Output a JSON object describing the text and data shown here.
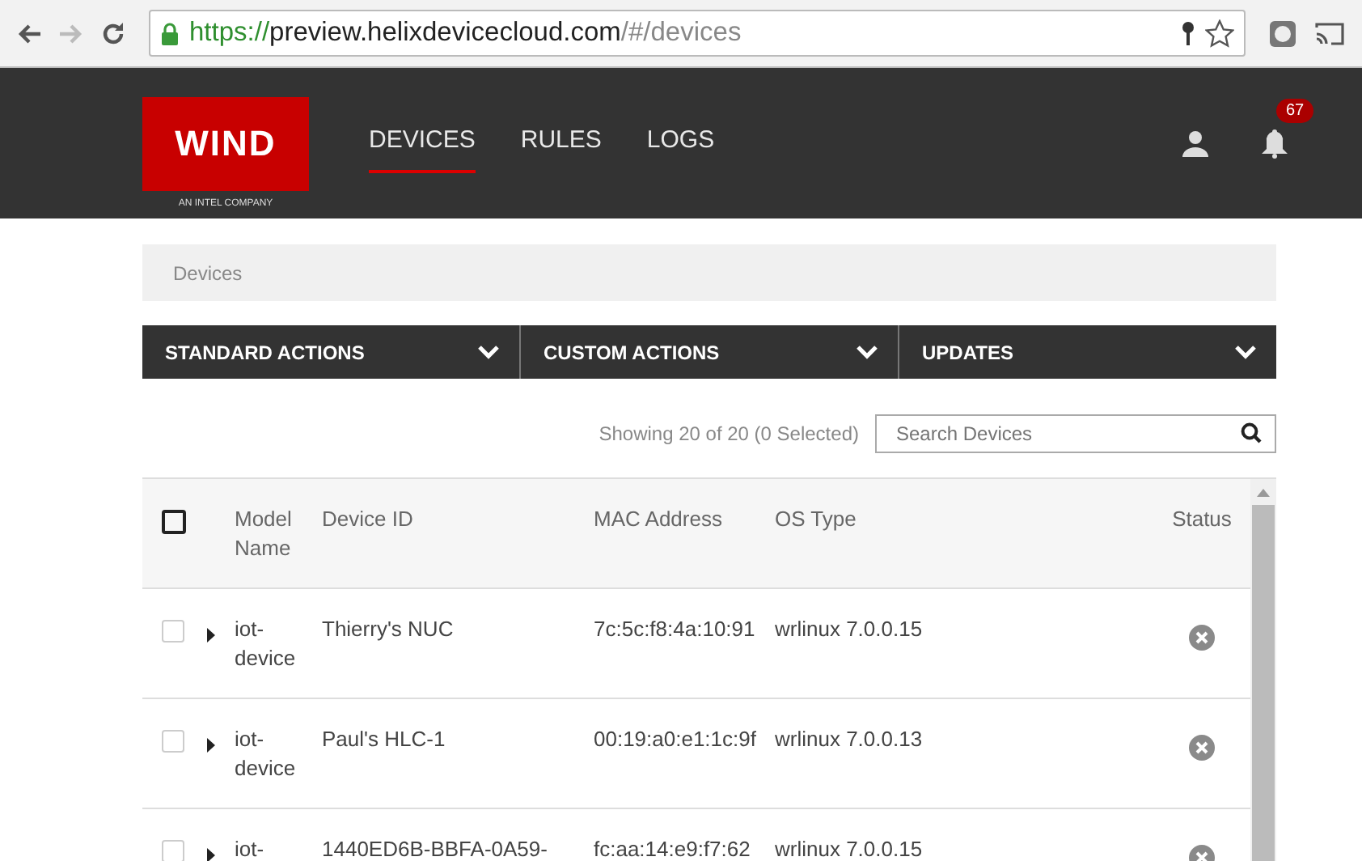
{
  "browser": {
    "url_scheme": "https://",
    "url_host": "preview.helixdevicecloud.com",
    "url_path": "/#/devices"
  },
  "header": {
    "logo": "WIND",
    "logo_tagline": "AN INTEL COMPANY",
    "nav": [
      {
        "label": "DEVICES",
        "selected": true
      },
      {
        "label": "RULES",
        "selected": false
      },
      {
        "label": "LOGS",
        "selected": false
      }
    ],
    "notification_count": "67"
  },
  "breadcrumb": "Devices",
  "action_menus": [
    "STANDARD ACTIONS",
    "CUSTOM ACTIONS",
    "UPDATES"
  ],
  "summary": "Showing 20 of 20 (0 Selected)",
  "search": {
    "placeholder": "Search Devices"
  },
  "table": {
    "select_all_checked": false,
    "columns": [
      "Model Name",
      "Device ID",
      "MAC Address",
      "OS Type",
      "Status"
    ],
    "rows": [
      {
        "checked": false,
        "model": "iot-device",
        "device_id": "Thierry's NUC",
        "mac": "7c:5c:f8:4a:10:91",
        "os": "wrlinux 7.0.0.15",
        "kind": "offline"
      },
      {
        "checked": false,
        "model": "iot-device",
        "device_id": "Paul's HLC-1",
        "mac": "00:19:a0:e1:1c:9f",
        "os": "wrlinux 7.0.0.13",
        "kind": "offline"
      },
      {
        "checked": false,
        "model": "iot-",
        "device_id": "1440ED6B-BBFA-0A59-",
        "mac": "fc:aa:14:e9:f7:62",
        "os": "wrlinux 7.0.0.15",
        "kind": "offline"
      }
    ]
  }
}
